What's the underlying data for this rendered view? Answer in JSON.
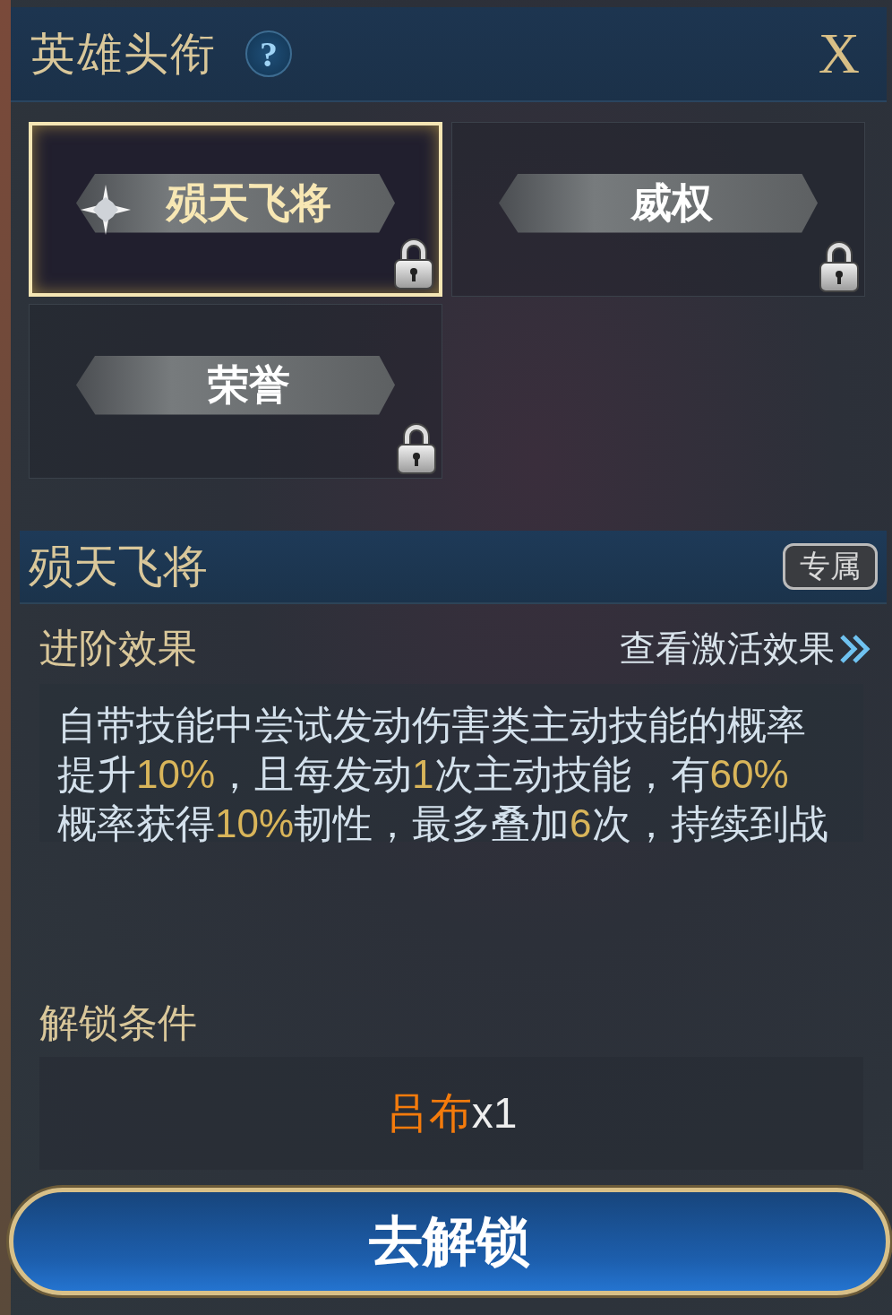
{
  "header": {
    "title": "英雄头衔",
    "help": "?",
    "close": "X"
  },
  "titles": [
    {
      "name": "殒天飞将",
      "selected": true,
      "equipped": true,
      "locked": true
    },
    {
      "name": "威权",
      "selected": false,
      "equipped": false,
      "locked": true
    },
    {
      "name": "荣誉",
      "selected": false,
      "equipped": false,
      "locked": true
    }
  ],
  "detail": {
    "name": "殒天飞将",
    "badge": "专属",
    "effect_heading": "进阶效果",
    "effect_link": "查看激活效果",
    "description_lines": [
      [
        {
          "text": "自带技能中尝试发动伤害类主动技能的概率",
          "highlight": false
        }
      ],
      [
        {
          "text": "提升",
          "highlight": false
        },
        {
          "text": "10%",
          "highlight": true
        },
        {
          "text": "，且每发动",
          "highlight": false
        },
        {
          "text": "1",
          "highlight": true
        },
        {
          "text": "次主动技能，有",
          "highlight": false
        },
        {
          "text": "60%",
          "highlight": true
        }
      ],
      [
        {
          "text": "概率获得",
          "highlight": false
        },
        {
          "text": "10%",
          "highlight": true
        },
        {
          "text": "韧性，最多叠加",
          "highlight": false
        },
        {
          "text": "6",
          "highlight": true
        },
        {
          "text": "次，持续到战",
          "highlight": false
        }
      ]
    ],
    "unlock_heading": "解锁条件",
    "unlock_item": "吕布",
    "unlock_count": "x1"
  },
  "action_button": "去解锁"
}
